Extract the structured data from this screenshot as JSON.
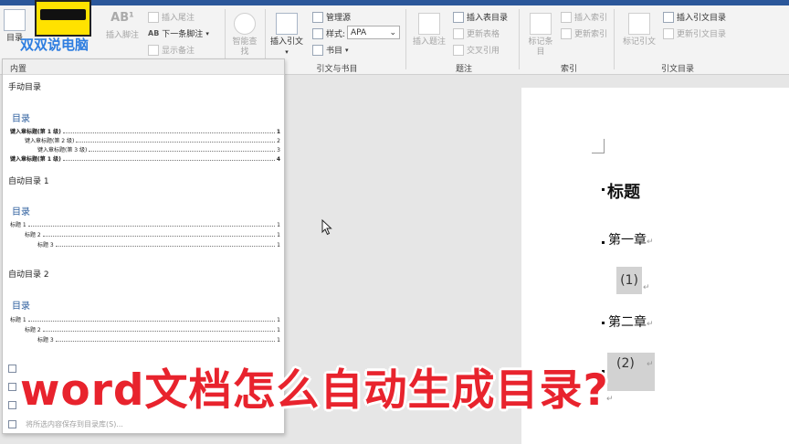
{
  "logo": {
    "text": "双双说电脑"
  },
  "ribbon": {
    "toc_button": "目录",
    "footnotes": {
      "insert_footnote": "插入脚注",
      "insert_endnote": "插入尾注",
      "next_footnote": "下一条脚注",
      "show_notes": "显示备注"
    },
    "research": {
      "smart_lookup": "智能查找"
    },
    "citations": {
      "group": "引文与书目",
      "insert_citation": "插入引文",
      "manage_sources": "管理源",
      "style_label": "样式:",
      "style_value": "APA",
      "bibliography": "书目"
    },
    "captions": {
      "group": "题注",
      "insert_caption": "插入题注",
      "insert_table_of_figures": "插入表目录",
      "update_table": "更新表格",
      "cross_reference": "交叉引用"
    },
    "index": {
      "group": "索引",
      "mark_entry": "标记条目",
      "insert_index": "插入索引",
      "update_index": "更新索引"
    },
    "table_of_authorities": {
      "group": "引文目录",
      "mark_citation": "标记引文",
      "insert_table": "插入引文目录",
      "update_table": "更新引文目录"
    }
  },
  "toc_menu": {
    "section_header": "内置",
    "manual": {
      "name": "手动目录",
      "title": "目录",
      "lines": [
        {
          "text": "键入章标题(第 1 级)",
          "page": "1"
        },
        {
          "text": "键入章标题(第 2 级)",
          "page": "2"
        },
        {
          "text": "键入章标题(第 3 级)",
          "page": "3"
        },
        {
          "text": "键入章标题(第 1 级)",
          "page": "4"
        }
      ]
    },
    "auto1": {
      "name": "自动目录 1",
      "title": "目录",
      "lines": [
        {
          "text": "标题 1",
          "page": "1"
        },
        {
          "text": "标题 2",
          "page": "1"
        },
        {
          "text": "标题 3",
          "page": "1"
        }
      ]
    },
    "auto2": {
      "name": "自动目录 2",
      "title": "目录",
      "lines": [
        {
          "text": "标题 1",
          "page": "1"
        },
        {
          "text": "标题 2",
          "page": "1"
        },
        {
          "text": "标题 3",
          "page": "1"
        }
      ]
    },
    "footer_save": "将所选内容保存到目录库(S)..."
  },
  "document": {
    "heading": "标题",
    "chapter1": "第一章",
    "item1": "(1)",
    "chapter2": "第二章",
    "item2": "(2)",
    "para_mark": "↵"
  },
  "caption": "word文档怎么自动生成目录?"
}
